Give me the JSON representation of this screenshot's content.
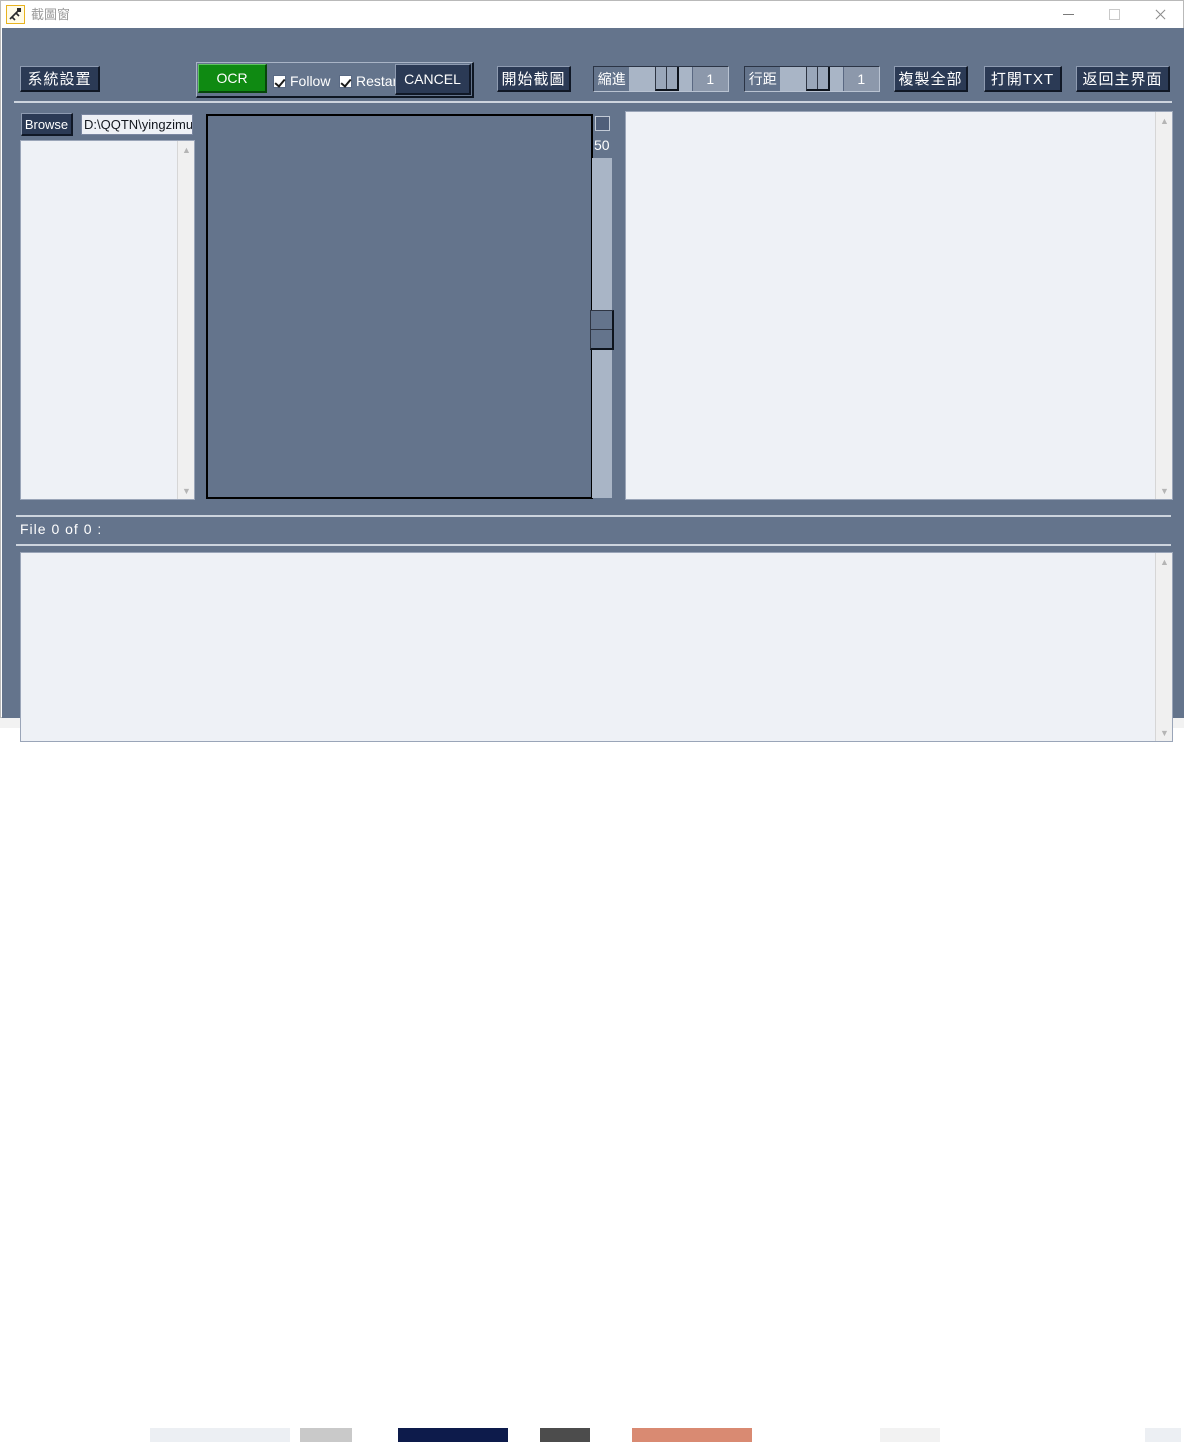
{
  "window": {
    "title": "截圖窗",
    "icon": "screenshot-tool-icon",
    "controls": {
      "minimize": "—",
      "maximize": "□",
      "close": "✕"
    }
  },
  "toolbar": {
    "system_settings": "系統設置",
    "ocr": "OCR",
    "follow": "Follow",
    "restart": "Restart",
    "cancel": "CANCEL",
    "start_capture": "開始截圖",
    "indent_label": "縮進",
    "indent_value": "1",
    "linespacing_label": "行距",
    "linespacing_value": "1",
    "copy_all": "複製全部",
    "open_txt": "打開TXT",
    "back_to_main": "返回主界面"
  },
  "file_row": {
    "browse": "Browse",
    "path_value": "D:\\QQTN\\yingzimu",
    "path_placeholder": "D:\\"
  },
  "preview": {
    "threshold_value": "50",
    "toggle": "threshold-toggle"
  },
  "status": {
    "file_counter": "File  0  of  0 :"
  },
  "colors": {
    "window_background": "#64748c",
    "button_face": "#2b3a55",
    "ocr_green": "#0f8a12",
    "panel_background": "#eef1f6",
    "accent_title_icon": "#e8b31f"
  }
}
